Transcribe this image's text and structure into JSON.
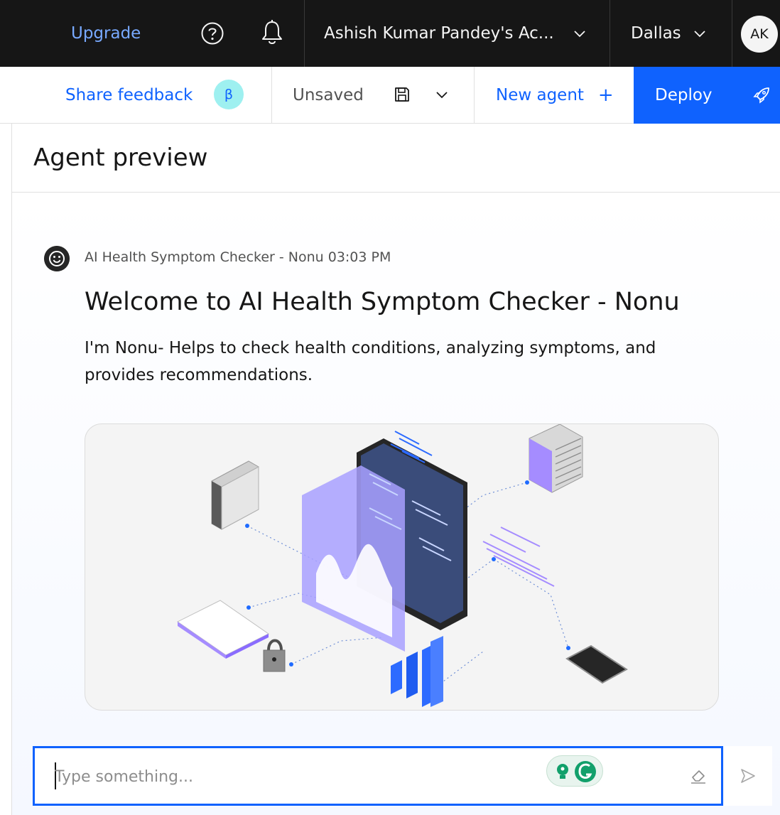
{
  "topbar": {
    "upgrade_label": "Upgrade",
    "help_icon": "help-circle-icon",
    "notification_icon": "bell-icon",
    "account_label": "Ashish Kumar Pandey's Ac...",
    "region_label": "Dallas",
    "avatar_initials": "AK"
  },
  "toolbar": {
    "share_feedback_label": "Share feedback",
    "beta_badge": "β",
    "save_status": "Unsaved",
    "save_icon": "save-icon",
    "new_agent_label": "New agent",
    "new_agent_icon": "+",
    "deploy_label": "Deploy",
    "deploy_icon": "rocket-icon"
  },
  "panel": {
    "title": "Agent preview",
    "message": {
      "sender": "AI Health Symptom Checker - Nonu 03:03 PM",
      "heading": "Welcome to  AI Health Symptom Checker - Nonu",
      "body": "I'm Nonu- Helps to check health conditions, analyzing symptoms, and provides recommendations."
    },
    "input": {
      "placeholder": "Type something...",
      "value": ""
    }
  },
  "colors": {
    "topbar_bg": "#161616",
    "accent": "#0f62fe",
    "upgrade_link": "#78a9ff",
    "beta_badge_bg": "#9ef0f0",
    "illustration_accent": "#8a6cff"
  }
}
